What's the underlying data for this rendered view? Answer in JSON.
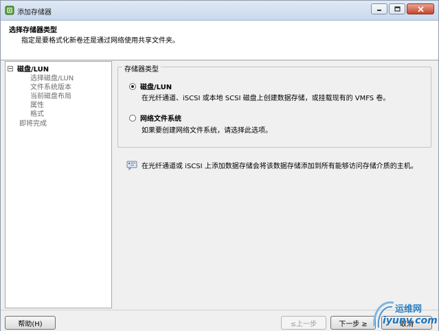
{
  "window": {
    "title": "添加存储器",
    "icon": "storage-app-icon"
  },
  "header": {
    "title": "选择存储器类型",
    "subtitle": "指定是要格式化新卷还是通过网络使用共享文件夹。"
  },
  "tree": {
    "root": "磁盘/LUN",
    "expander": "−",
    "children": [
      "选择磁盘/LUN",
      "文件系统版本",
      "当前磁盘布局",
      "属性",
      "格式"
    ],
    "sibling": "即将完成"
  },
  "storage_type": {
    "legend": "存储器类型",
    "options": [
      {
        "label": "磁盘/LUN",
        "description": "在光纤通道、iSCSI 或本地 SCSI 磁盘上创建数据存储，或挂载现有的 VMFS 卷。",
        "selected": true
      },
      {
        "label": "网络文件系统",
        "description": "如果要创建网络文件系统，请选择此选项。",
        "selected": false
      }
    ]
  },
  "info_message": "在光纤通道或 iSCSI 上添加数据存储会将该数据存储添加到所有能够访问存储介质的主机。",
  "footer": {
    "help": "帮助(H)",
    "back": "≤上一步",
    "next": "下一步 ≥",
    "cancel": "取消"
  },
  "watermark": {
    "line1": "运维网",
    "line2": "iyunv.com"
  }
}
